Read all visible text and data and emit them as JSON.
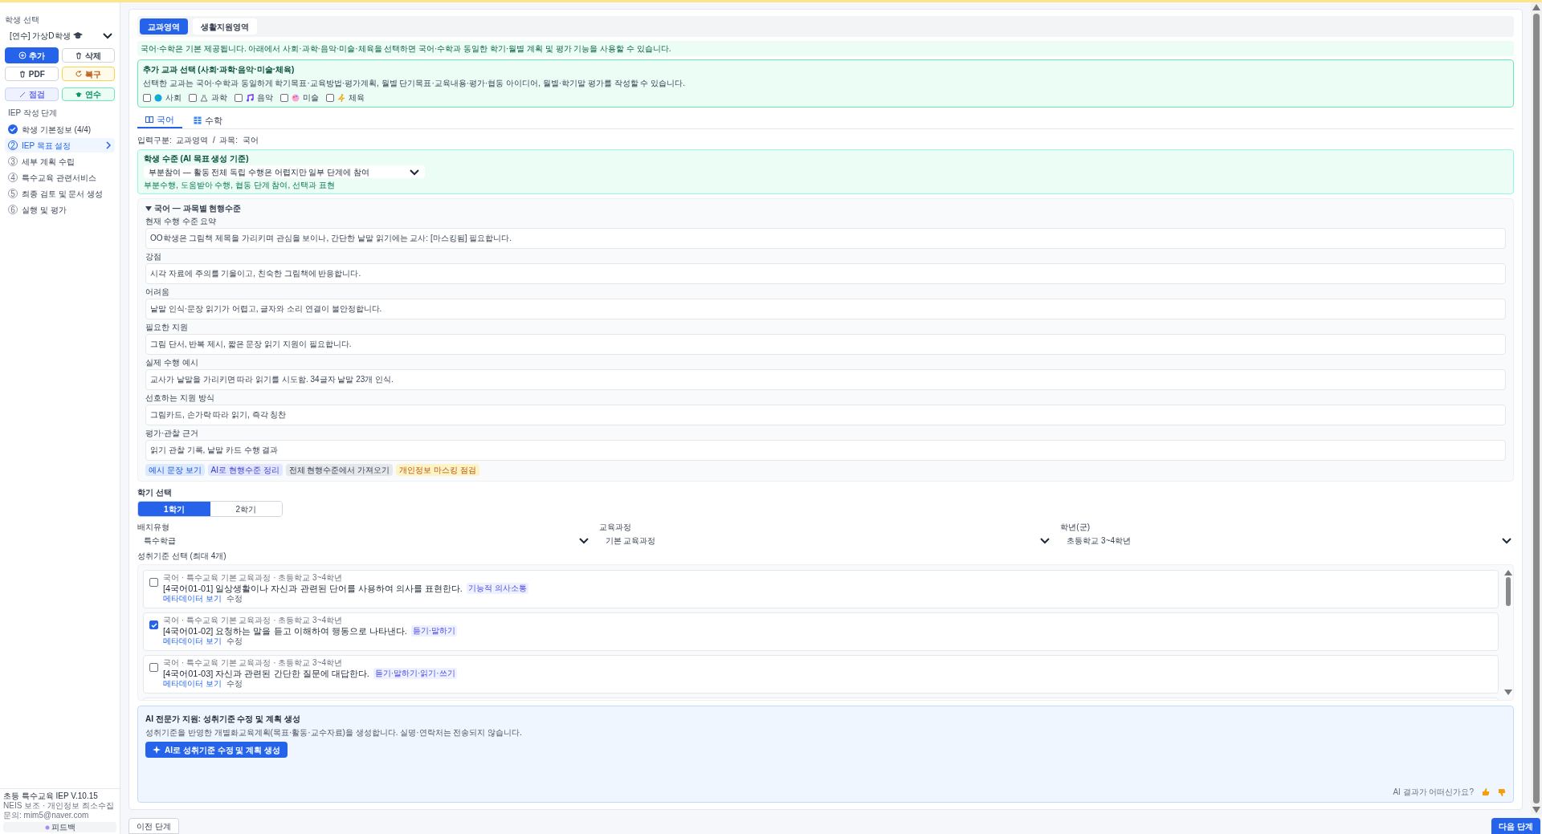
{
  "sidebar": {
    "student_select": {
      "label": "학생 선택",
      "value": "[연수] 가상D학생"
    },
    "buttons": [
      {
        "label": "추가",
        "kind": "primary"
      },
      {
        "label": "삭제",
        "kind": "outline"
      },
      {
        "label": "PDF",
        "kind": "outline"
      },
      {
        "label": "복구",
        "kind": "warning"
      },
      {
        "label": "점검",
        "kind": "indigo"
      },
      {
        "label": "연수",
        "kind": "green"
      }
    ],
    "steps_title": "IEP 작성 단계",
    "steps": [
      {
        "label": "학생 기본정보 (4/4)",
        "done": true,
        "selected": false
      },
      {
        "number": "2",
        "label": "IEP 목표 설정",
        "done": false,
        "selected": true
      },
      {
        "number": "3",
        "label": "세부 계획 수립",
        "done": false,
        "selected": false
      },
      {
        "number": "4",
        "label": "특수교육 관련서비스",
        "done": false,
        "selected": false
      },
      {
        "number": "5",
        "label": "최종 검토 및 문서 생성",
        "done": false,
        "selected": false
      },
      {
        "number": "6",
        "label": "실행 및 평가",
        "done": false,
        "selected": false
      }
    ],
    "footer": [
      "초등 특수교육 IEP V.10.15",
      "NEIS 보조 · 개인정보 최소수집",
      "문의: mim5@naver.com"
    ],
    "feedback_button": "피드백"
  },
  "area_tabs": [
    {
      "label": "교과영역",
      "selected": true
    },
    {
      "label": "생활지원영역",
      "selected": false
    }
  ],
  "notice": "국어·수학은 기본 제공됩니다. 아래에서 사회·과학·음악·미술·체육을 선택하면 국어·수학과 동일한 학기·월별 계획 및 평가 기능을 사용할 수 있습니다.",
  "extra_subjects": {
    "title": "추가 교과 선택 (사회·과학·음악·미술·체육)",
    "description": "선택한 교과는 국어·수학과 동일하게 학기목표·교육방법·평가계획, 월별 단기목표·교육내용·평가·협동 아이디어, 월별·학기말 평가를 작성할 수 있습니다.",
    "options": [
      {
        "label": "사회",
        "checked": false
      },
      {
        "label": "과학",
        "checked": false
      },
      {
        "label": "음악",
        "checked": false
      },
      {
        "label": "미술",
        "checked": false
      },
      {
        "label": "체육",
        "checked": false
      }
    ]
  },
  "subject_tabs": [
    {
      "label": "국어",
      "selected": true
    },
    {
      "label": "수학",
      "selected": false
    }
  ],
  "input_info": "입력구분:  교과영역  /  과목:  국어",
  "student_level": {
    "title": "학생 수준 (AI 목표 생성 기준)",
    "value": "부분참여 — 활동 전체 독립 수행은 어렵지만 일부 단계에 참여",
    "hint": "부분수행, 도움받아 수행, 협동 단계 참여, 선택과 표현"
  },
  "present_level": {
    "title": "국어 — 과목별 현행수준",
    "expanded": true,
    "fields": [
      {
        "label": "현재 수행 수준 요약",
        "value": "OO학생은 그림책 제목을 가리키며 관심을 보이나, 간단한 낱말 읽기에는 교사: [마스킹됨] 필요합니다."
      },
      {
        "label": "강점",
        "value": "시각 자료에 주의를 기울이고, 친숙한 그림책에 반응합니다."
      },
      {
        "label": "어려움",
        "value": "낱말 인식·문장 읽기가 어렵고, 글자와 소리 연결이 불안정합니다."
      },
      {
        "label": "필요한 지원",
        "value": "그림 단서, 반복 제시, 짧은 문장 읽기 지원이 필요합니다."
      },
      {
        "label": "실제 수행 예시",
        "value": "교사가 낱말을 가리키면 따라 읽기를 시도함. 34글자 낱말 23개 인식."
      },
      {
        "label": "선호하는 지원 방식",
        "value": "그림카드, 손가락 따라 읽기, 즉각 칭찬"
      },
      {
        "label": "평가·관찰 근거",
        "value": "읽기 관찰 기록, 낱말 카드 수행 결과"
      }
    ],
    "actions": [
      {
        "label": "예시 문장 보기",
        "kind": "blue"
      },
      {
        "label": "AI로 현행수준 정리",
        "kind": "indigo"
      },
      {
        "label": "전체 현행수준에서 가져오기",
        "kind": "gray"
      },
      {
        "label": "개인정보 마스킹 점검",
        "kind": "amber"
      }
    ]
  },
  "semester": {
    "label": "학기 선택",
    "options": [
      {
        "label": "1학기",
        "selected": true
      },
      {
        "label": "2학기",
        "selected": false
      }
    ]
  },
  "selects": [
    {
      "label": "배치유형",
      "value": "특수학급"
    },
    {
      "label": "교육과정",
      "value": "기본 교육과정"
    },
    {
      "label": "학년(군)",
      "value": "초등학교 3~4학년"
    }
  ],
  "standards": {
    "label": "성취기준 선택 (최대 4개)",
    "items": [
      {
        "meta": "국어 · 특수교육 기본 교육과정 · 초등학교 3~4학년",
        "text": "[4국어01-01] 일상생활이나 자신과 관련된 단어를 사용하여 의사를 표현한다.",
        "tag": "기능적 의사소통",
        "links": [
          "메타데이터 보기",
          "수정"
        ],
        "checked": false
      },
      {
        "meta": "국어 · 특수교육 기본 교육과정 · 초등학교 3~4학년",
        "text": "[4국어01-02] 요청하는 말을 듣고 이해하여 행동으로 나타낸다.",
        "tag": "듣기·말하기",
        "links": [
          "메타데이터 보기",
          "수정"
        ],
        "checked": true
      },
      {
        "meta": "국어 · 특수교육 기본 교육과정 · 초등학교 3~4학년",
        "text": "[4국어01-03] 자신과 관련된 간단한 질문에 대답한다.",
        "tag": "듣기·말하기·읽기·쓰기",
        "links": [
          "메타데이터 보기",
          "수정"
        ],
        "checked": false
      }
    ]
  },
  "ai_panel": {
    "title": "AI 전문가 지원: 성취기준 수정 및 계획 생성",
    "description": "성취기준을 반영한 개별화교육계획(목표·활동·교수자료)을 생성합니다. 실명·연락처는 전송되지 않습니다.",
    "button": "AI로 성취기준 수정 및 계획 생성",
    "feedback_question": "AI 결과가 어떠신가요?"
  },
  "nav": {
    "prev": "이전 단계",
    "next": "다음 단계"
  }
}
